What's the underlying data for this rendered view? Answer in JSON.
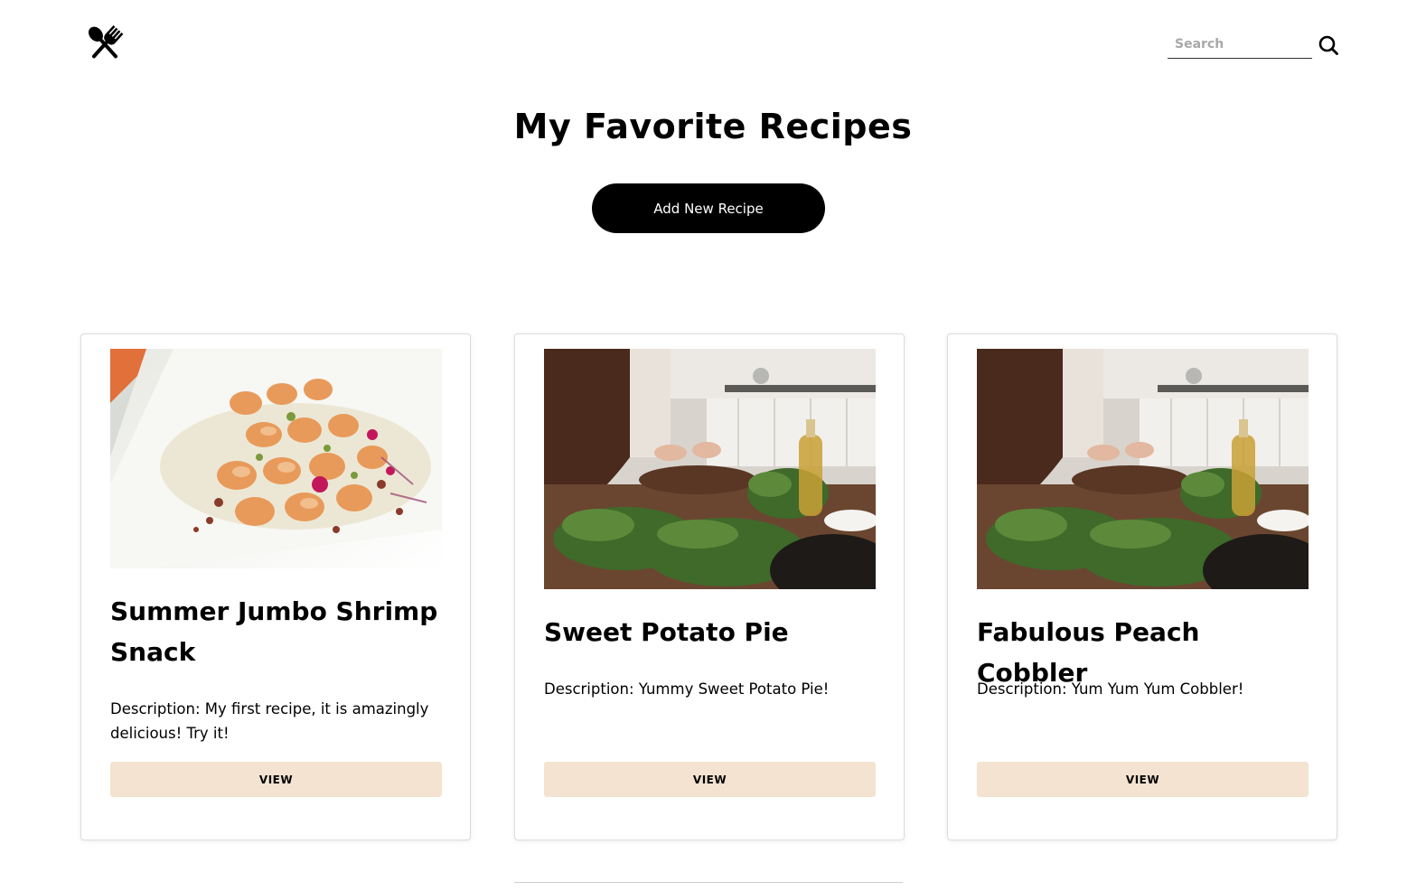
{
  "header": {
    "logo_icon": "utensils-crossed-icon",
    "search": {
      "placeholder": "Search",
      "value": "",
      "icon": "search-icon"
    }
  },
  "main": {
    "title": "My Favorite Recipes",
    "add_button_label": "Add New Recipe"
  },
  "recipes": [
    {
      "title": "Summer Jumbo Shrimp Snack",
      "description": "Description: My first recipe, it is amazingly delicious! Try it!",
      "image": "shrimp-dish-photo",
      "button_label": "VIEW"
    },
    {
      "title": "Sweet Potato Pie",
      "description": "Description: Yummy Sweet Potato Pie!",
      "image": "kitchen-prep-photo",
      "button_label": "VIEW"
    },
    {
      "title": "Fabulous Peach Cobbler",
      "description": "Description: Yum Yum Yum Cobbler!",
      "image": "kitchen-prep-photo",
      "button_label": "VIEW"
    }
  ],
  "colors": {
    "primary_button": "#000000",
    "view_button": "#f3e3d0",
    "card_border": "#dcdcdc"
  }
}
